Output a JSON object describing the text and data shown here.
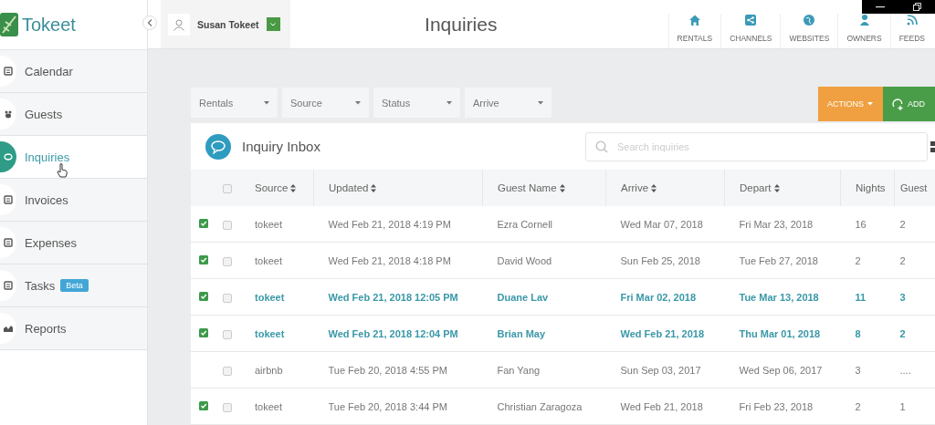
{
  "brand": {
    "name": "Tokeet"
  },
  "user": {
    "name": "Susan Tokeet"
  },
  "page_title": "Inquiries",
  "nav": [
    {
      "label": "RENTALS"
    },
    {
      "label": "CHANNELS"
    },
    {
      "label": "WEBSITES"
    },
    {
      "label": "OWNERS"
    },
    {
      "label": "FEEDS"
    }
  ],
  "sidebar": {
    "items": [
      {
        "label": "Calendar",
        "selected": false
      },
      {
        "label": "Guests",
        "selected": false
      },
      {
        "label": "Inquiries",
        "selected": true
      },
      {
        "label": "Invoices",
        "selected": false
      },
      {
        "label": "Expenses",
        "selected": false
      },
      {
        "label": "Tasks",
        "selected": false,
        "badge": "Beta"
      },
      {
        "label": "Reports",
        "selected": false
      }
    ]
  },
  "filters": [
    {
      "label": "Rentals"
    },
    {
      "label": "Source"
    },
    {
      "label": "Status"
    },
    {
      "label": "Arrive"
    }
  ],
  "buttons": [
    {
      "label": "ACTIONS",
      "kind": "actions"
    },
    {
      "label": "ADD",
      "kind": "add"
    }
  ],
  "inbox": {
    "title": "Inquiry Inbox",
    "search": {
      "placeholder": "Search inquiries"
    }
  },
  "table": {
    "all_selected": false,
    "columns": [
      {
        "label": "Source",
        "sortable": true
      },
      {
        "label": "Updated",
        "sortable": true
      },
      {
        "label": "Guest Name",
        "sortable": true
      },
      {
        "label": "Arrive",
        "sortable": true
      },
      {
        "label": "Depart",
        "sortable": true
      },
      {
        "label": "Nights",
        "sortable": false
      },
      {
        "label": "Guest",
        "sortable": false
      }
    ],
    "rows": [
      {
        "replied": true,
        "selected": false,
        "unread": false,
        "cells": [
          "tokeet",
          "Wed Feb 21, 2018 4:19 PM",
          "Ezra Cornell",
          "Wed Mar 07, 2018",
          "Fri Mar 23, 2018",
          "16",
          "2"
        ]
      },
      {
        "replied": true,
        "selected": false,
        "unread": false,
        "cells": [
          "tokeet",
          "Wed Feb 21, 2018 4:18 PM",
          "David Wood",
          "Sun Feb 25, 2018",
          "Tue Feb 27, 2018",
          "2",
          "2"
        ]
      },
      {
        "replied": true,
        "selected": false,
        "unread": true,
        "cells": [
          "tokeet",
          "Wed Feb 21, 2018 12:05 PM",
          "Duane Lav",
          "Fri Mar 02, 2018",
          "Tue Mar 13, 2018",
          "11",
          "3"
        ]
      },
      {
        "replied": true,
        "selected": false,
        "unread": true,
        "cells": [
          "tokeet",
          "Wed Feb 21, 2018 12:04 PM",
          "Brian May",
          "Wed Feb 21, 2018",
          "Thu Mar 01, 2018",
          "8",
          "2"
        ]
      },
      {
        "replied": false,
        "selected": false,
        "unread": false,
        "cells": [
          "airbnb",
          "Tue Feb 20, 2018 4:55 PM",
          "Fan Yang",
          "Sun Sep 03, 2017",
          "Wed Sep 06, 2017",
          "3",
          "...."
        ]
      },
      {
        "replied": true,
        "selected": false,
        "unread": false,
        "cells": [
          "tokeet",
          "Tue Feb 20, 2018 3:44 PM",
          "Christian Zaragoza",
          "Wed Feb 21, 2018",
          "Fri Feb 23, 2018",
          "2",
          "1"
        ]
      }
    ]
  }
}
